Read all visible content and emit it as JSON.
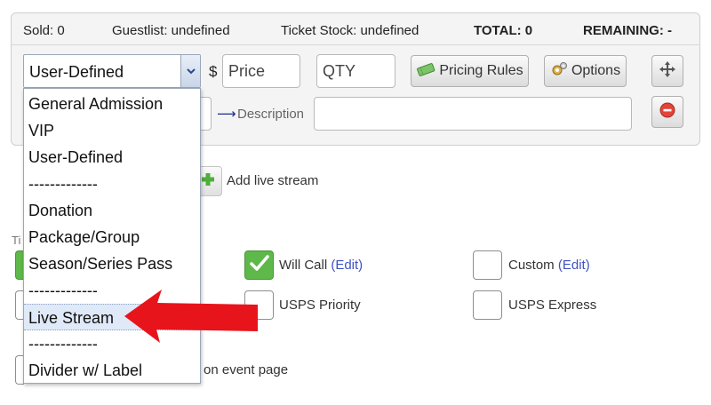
{
  "stats": {
    "sold": "Sold: 0",
    "guestlist": "Guestlist: undefined",
    "ticket_stock": "Ticket Stock: undefined",
    "total": "TOTAL: 0",
    "remaining": "REMAINING: -"
  },
  "ticket_row": {
    "type_value": "User-Defined",
    "currency_symbol": "$",
    "price_placeholder": "Price",
    "qty_placeholder": "QTY",
    "pricing_rules_label": "Pricing Rules",
    "options_label": "Options",
    "description_label": "Description"
  },
  "dropdown": {
    "items": [
      "General Admission",
      "VIP",
      "User-Defined",
      "-------------",
      "Donation",
      "Package/Group",
      "Season/Series Pass",
      "-------------",
      "Live Stream",
      "-------------",
      "Divider w/ Label"
    ],
    "selected": "Live Stream"
  },
  "add_live_stream_label": "Add live stream",
  "ticket_section_stub": "Ti",
  "delivery_options": {
    "will_call": {
      "label": "Will Call",
      "edit": "(Edit)",
      "checked": true
    },
    "custom": {
      "label": "Custom",
      "edit": "(Edit)",
      "checked": false
    },
    "usps_priority": {
      "label": "USPS Priority",
      "checked": false
    },
    "usps_express": {
      "label": "USPS Express",
      "checked": false
    }
  },
  "event_page_label": "on event page",
  "colors": {
    "check_green": "#5fb84a",
    "link_blue": "#3e52c4",
    "annotation_red": "#e8141b",
    "selection_bg": "#dfe9f7"
  }
}
